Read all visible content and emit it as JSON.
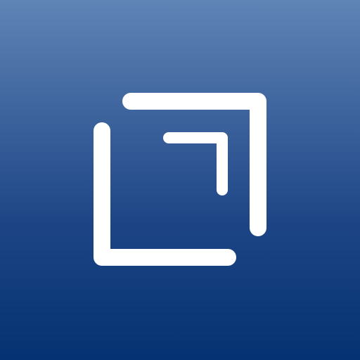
{
  "app_icon": {
    "icon": "nested-corner-brackets-icon",
    "colors": {
      "gradient_top": "#5f84b6",
      "gradient_mid": "#1d4585",
      "gradient_bottom": "#053272",
      "glyph": "#ffffff"
    }
  }
}
